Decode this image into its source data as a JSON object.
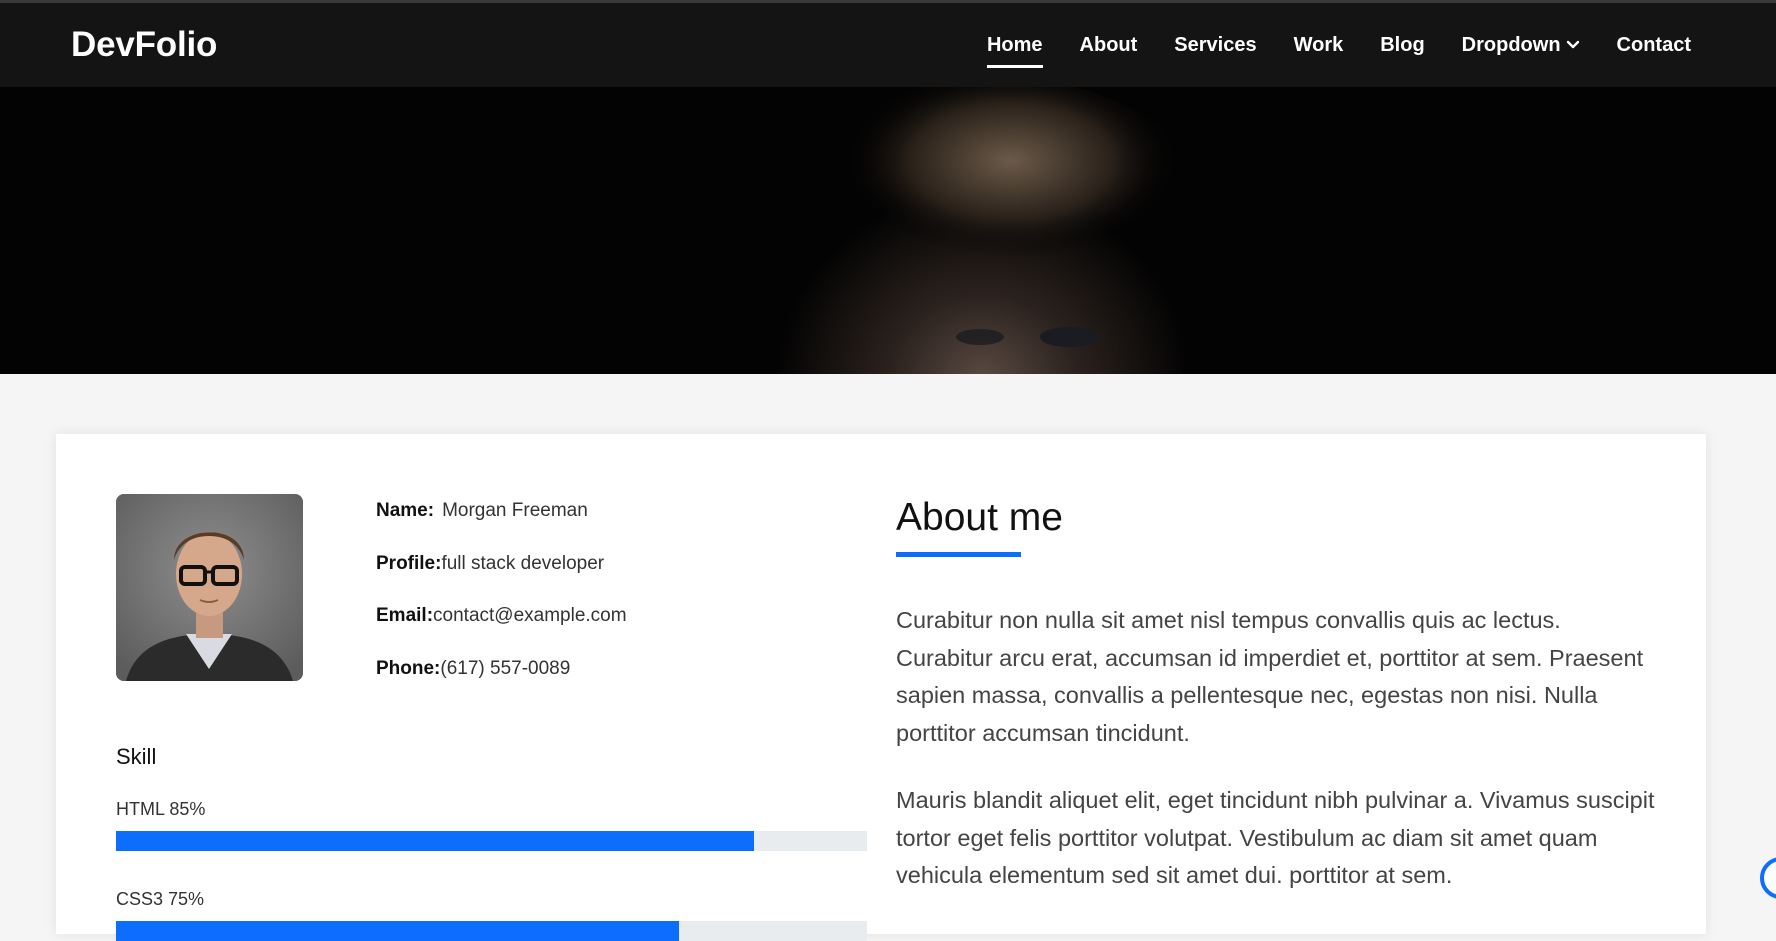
{
  "brand": "DevFolio",
  "nav": {
    "items": [
      {
        "label": "Home"
      },
      {
        "label": "About"
      },
      {
        "label": "Services"
      },
      {
        "label": "Work"
      },
      {
        "label": "Blog"
      },
      {
        "label": "Dropdown"
      },
      {
        "label": "Contact"
      }
    ],
    "active": "Home",
    "dropdown_icon": "chevron-down-icon"
  },
  "profile": {
    "name_label": "Name:",
    "name_value": "Morgan Freeman",
    "profile_label": "Profile:",
    "profile_value": "full stack developer",
    "email_label": "Email:",
    "email_value": "contact@example.com",
    "phone_label": "Phone:",
    "phone_value": "(617) 557-0089"
  },
  "skills": {
    "title": "Skill",
    "items": [
      {
        "label": "HTML 85%",
        "percent": 85
      },
      {
        "label": "CSS3 75%",
        "percent": 75
      }
    ]
  },
  "about": {
    "title": "About me",
    "paragraphs": [
      "Curabitur non nulla sit amet nisl tempus convallis quis ac lectus. Curabitur arcu erat, accumsan id imperdiet et, porttitor at sem. Praesent sapien massa, convallis a pellentesque nec, egestas non nisi. Nulla porttitor accumsan tincidunt.",
      "Mauris blandit aliquet elit, eget tincidunt nibh pulvinar a. Vivamus suscipit tortor eget felis porttitor volutpat. Vestibulum ac diam sit amet quam vehicula elementum sed sit amet dui. porttitor at sem."
    ]
  },
  "colors": {
    "accent": "#0d6efd",
    "navbar_bg": "#141414",
    "page_bg": "#f5f5f5"
  }
}
